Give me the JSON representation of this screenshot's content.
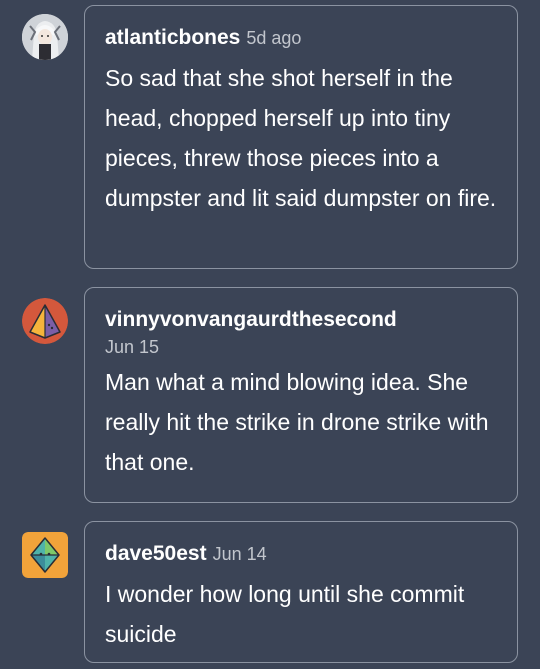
{
  "comments": [
    {
      "username": "atlanticbones",
      "date": "5d ago",
      "text": "So sad that she shot herself in the head, chopped herself up into tiny pieces, threw those pieces into a dumpster and lit said dumpster on fire."
    },
    {
      "username": "vinnyvonvangaurdthesecond",
      "date": "Jun 15",
      "text": "Man what a mind blowing idea. She really hit the strike in drone strike with that one."
    },
    {
      "username": "dave50est",
      "date": "Jun 14",
      "text": "I wonder how long until she commit suicide"
    }
  ],
  "colors": {
    "background": "#3b4456",
    "border": "#8b93a1",
    "avatar2_bg": "#d4583c",
    "avatar3_bg": "#f2a33a"
  },
  "icons": [
    "avatar-anime-icon",
    "avatar-pyramid-icon",
    "avatar-diamond-icon"
  ]
}
